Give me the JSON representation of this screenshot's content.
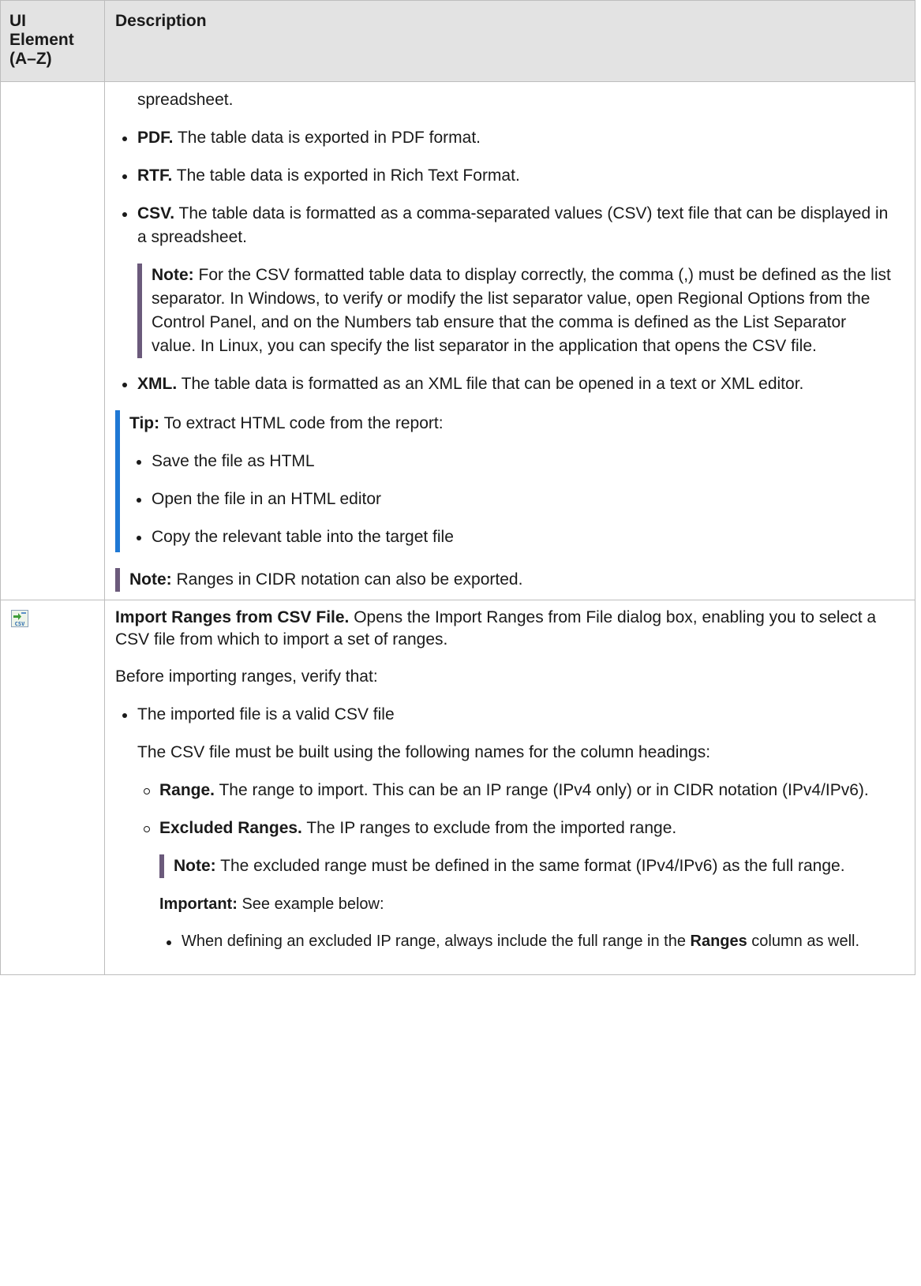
{
  "table": {
    "headers": {
      "col1_line1": "UI",
      "col1_line2": "Element",
      "col1_line3": "(A–Z)",
      "col2": "Description"
    },
    "row1": {
      "continuation": "spreadsheet.",
      "formats": [
        {
          "label": "PDF.",
          "text": " The table data is exported in PDF format."
        },
        {
          "label": "RTF.",
          "text": " The table data is exported in Rich Text Format."
        },
        {
          "label": "CSV.",
          "text": " The table data is formatted as a comma-separated values (CSV) text file that can be displayed in a spreadsheet."
        },
        {
          "label": "XML.",
          "text": " The table data is formatted as an XML file that can be opened in a text or XML editor."
        }
      ],
      "csv_note": {
        "label": "Note:",
        "text": "  For the CSV formatted table data to display correctly, the comma (,) must be defined as the list separator. In Windows, to verify or modify the list separator value, open Regional Options from the Control Panel, and on the Numbers tab ensure that the comma is defined as the List Separator value. In Linux, you can specify the list separator in the application that opens the CSV file."
      },
      "tip": {
        "label": "Tip:",
        "text": "  To extract HTML code from the report:",
        "items": [
          "Save the file as HTML",
          "Open the file in an HTML editor",
          "Copy the relevant table into the target file"
        ]
      },
      "cidr_note": {
        "label": "Note:",
        "text": "  Ranges in CIDR notation can also be exported."
      }
    },
    "row2": {
      "icon": "import-csv-icon",
      "title": "Import Ranges from CSV File.",
      "title_text": " Opens the Import Ranges from File dialog box, enabling you to select a CSV file from which to import a set of ranges.",
      "verify_intro": "Before importing ranges, verify that:",
      "valid_item": "The imported file is a valid CSV file",
      "headings_intro": "The CSV file must be built using the following names for the column headings:",
      "columns": [
        {
          "label": "Range.",
          "text": " The range to import. This can be an IP range (IPv4 only) or in CIDR notation (IPv4/IPv6)."
        },
        {
          "label": "Excluded Ranges.",
          "text": " The IP ranges to exclude from the imported range."
        }
      ],
      "excluded_note": {
        "label": "Note:",
        "text": "  The excluded range must be defined in the same format (IPv4/IPv6) as the full range."
      },
      "important": {
        "label": "Important:",
        "text": " See example below:"
      },
      "example_item": {
        "before": "When defining an excluded IP range, always include the full range in the ",
        "bold": "Ranges",
        "after": " column as well."
      }
    }
  }
}
